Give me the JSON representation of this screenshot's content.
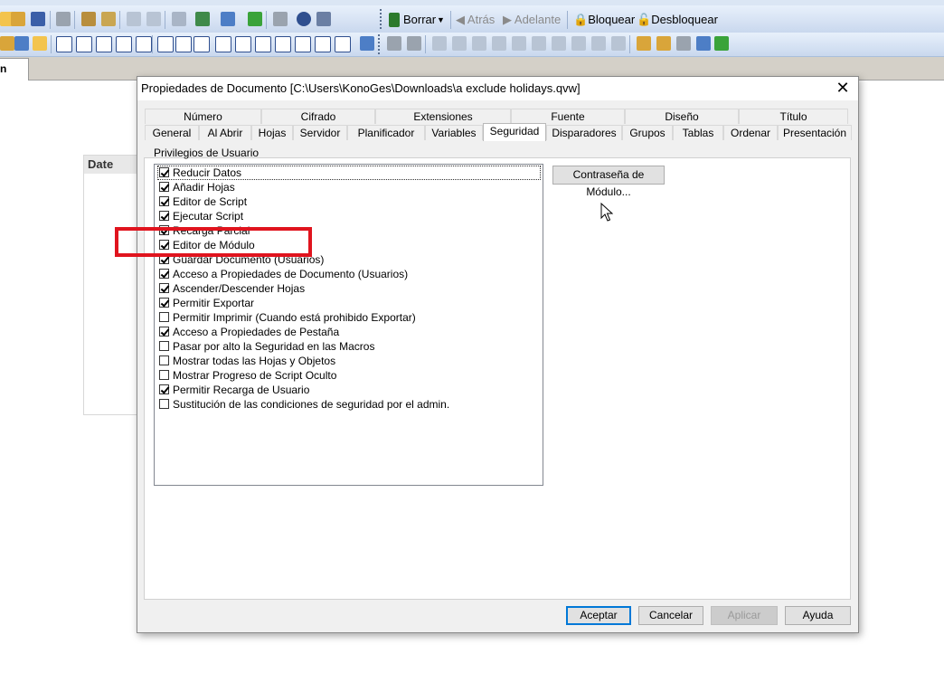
{
  "toolbar": {
    "borrar": "Borrar",
    "atras": "Atrás",
    "adelante": "Adelante",
    "bloquear": "Bloquear",
    "desbloquear": "Desbloquear"
  },
  "doc_tab": {
    "label": "n"
  },
  "sheet_object": {
    "title": "Date"
  },
  "dialog": {
    "title": "Propiedades de Documento [C:\\Users\\KonoGes\\Downloads\\a exclude holidays.qvw]",
    "close": "✕",
    "tabs_row1": [
      "Número",
      "Cifrado",
      "Extensiones",
      "Fuente",
      "Diseño",
      "Título"
    ],
    "tabs_row2": [
      "General",
      "Al Abrir",
      "Hojas",
      "Servidor",
      "Planificador",
      "Variables",
      "Seguridad",
      "Disparadores",
      "Grupos",
      "Tablas",
      "Ordenar",
      "Presentación"
    ],
    "active_tab": "Seguridad",
    "group_label": "Privilegios de Usuario",
    "module_password_button": "Contraseña de Módulo...",
    "privileges": [
      {
        "label": "Reducir Datos",
        "checked": true
      },
      {
        "label": "Añadir Hojas",
        "checked": true
      },
      {
        "label": "Editor de Script",
        "checked": true
      },
      {
        "label": "Ejecutar Script",
        "checked": true
      },
      {
        "label": "Recarga Parcial",
        "checked": true
      },
      {
        "label": "Editor de Módulo",
        "checked": true
      },
      {
        "label": "Guardar Documento (Usuarios)",
        "checked": true
      },
      {
        "label": "Acceso a Propiedades de Documento (Usuarios)",
        "checked": true
      },
      {
        "label": "Ascender/Descender Hojas",
        "checked": true
      },
      {
        "label": "Permitir Exportar",
        "checked": true
      },
      {
        "label": " Permitir Imprimir (Cuando está prohibido Exportar)",
        "checked": false
      },
      {
        "label": "Acceso a Propiedades de Pestaña",
        "checked": true
      },
      {
        "label": "Pasar por alto la Seguridad en las Macros",
        "checked": false
      },
      {
        "label": "Mostrar todas las Hojas y Objetos",
        "checked": false
      },
      {
        "label": "Mostrar Progreso de Script Oculto",
        "checked": false
      },
      {
        "label": "Permitir Recarga de Usuario",
        "checked": true
      },
      {
        "label": "Sustitución de las condiciones de seguridad por el admin.",
        "checked": false
      }
    ],
    "buttons": {
      "ok": "Aceptar",
      "cancel": "Cancelar",
      "apply": "Aplicar",
      "help": "Ayuda"
    }
  },
  "colors": {
    "highlight": "#e0141e",
    "focus_border": "#0078d7"
  }
}
